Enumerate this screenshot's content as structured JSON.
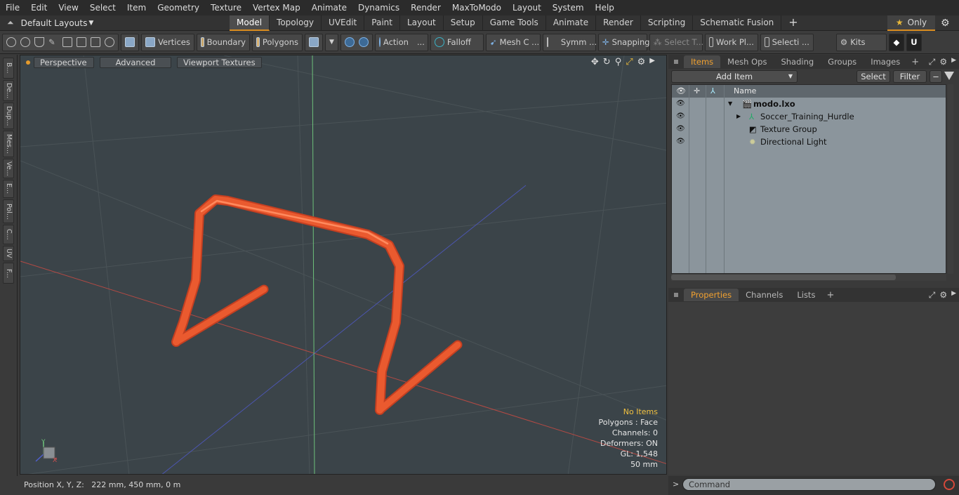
{
  "menu": [
    "File",
    "Edit",
    "View",
    "Select",
    "Item",
    "Geometry",
    "Texture",
    "Vertex Map",
    "Animate",
    "Dynamics",
    "Render",
    "MaxToModo",
    "Layout",
    "System",
    "Help"
  ],
  "layout_dropdown": "Default Layouts",
  "mode_tabs": [
    "Model",
    "Topology",
    "UVEdit",
    "Paint",
    "Layout",
    "Setup",
    "Game Tools",
    "Animate",
    "Render",
    "Scripting",
    "Schematic Fusion"
  ],
  "active_mode_tab": "Model",
  "only_label": "Only",
  "toolbar": {
    "vertices": "Vertices",
    "boundary": "Boundary",
    "polygons": "Polygons",
    "action": "Action",
    "action_more": "...",
    "falloff": "Falloff",
    "mesh_c": "Mesh C ...",
    "symm": "Symm ...",
    "snapping": "Snapping",
    "select_t": "Select T...",
    "work_pl": "Work Pl...",
    "selecti": "Selecti ...",
    "kits": "Kits"
  },
  "left_tabs": [
    "B...",
    "De...",
    "Dup...",
    "Mes...",
    "Ve...",
    "E...",
    "Pol...",
    "C...",
    "UV",
    "F..."
  ],
  "viewport": {
    "perspective": "Perspective",
    "advanced": "Advanced",
    "viewport_textures": "Viewport Textures",
    "info": {
      "no_items": "No Items",
      "polygons": "Polygons : Face",
      "channels": "Channels: 0",
      "deformers": "Deformers: ON",
      "gl": "GL: 1,548",
      "scale": "50 mm"
    },
    "axis_y": "Y",
    "axis_x": "X"
  },
  "status_bar": "Position X, Y, Z:   222 mm, 450 mm, 0 m",
  "items_panel": {
    "tabs": [
      "Items",
      "Mesh Ops",
      "Shading",
      "Groups",
      "Images"
    ],
    "active_tab": "Items",
    "add_item": "Add Item",
    "select": "Select",
    "filter": "Filter",
    "name_header": "Name",
    "rows": [
      "modo.lxo",
      "Soccer_Training_Hurdle",
      "Texture Group",
      "Directional Light"
    ]
  },
  "properties_panel": {
    "tabs": [
      "Properties",
      "Channels",
      "Lists"
    ],
    "active_tab": "Properties"
  },
  "command": {
    "prompt": ">",
    "placeholder": "Command"
  },
  "colors": {
    "accent": "#d98c1f",
    "hurdle": "#e8552f",
    "viewport_bg": "#3b4449",
    "x_axis": "#c0392b",
    "y_axis": "#4caf50",
    "z_axis": "#3f51b5"
  }
}
